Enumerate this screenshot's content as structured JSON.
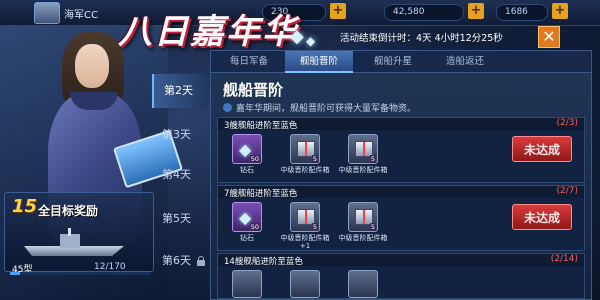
{
  "hud": {
    "player_name": "海军CC",
    "res1": "230",
    "res2": "42,580",
    "res3": "1686"
  },
  "event": {
    "title": "八日嘉年华",
    "countdown": "活动结束倒计时：4天 4小时12分25秒",
    "close_label": "✕"
  },
  "reward": {
    "count": "15",
    "title": "全目标奖励",
    "ship_category": "45型",
    "progress": "12/170",
    "progress_fraction": 0.07
  },
  "days": [
    {
      "label": "第2天",
      "active": true,
      "locked": false
    },
    {
      "label": "第3天",
      "active": false,
      "locked": false
    },
    {
      "label": "第4天",
      "active": false,
      "locked": false
    },
    {
      "label": "第5天",
      "active": false,
      "locked": false
    },
    {
      "label": "第6天",
      "active": false,
      "locked": true
    }
  ],
  "tabs": [
    {
      "label": "每日军备",
      "active": false
    },
    {
      "label": "舰船晋阶",
      "active": true
    },
    {
      "label": "舰船升星",
      "active": false
    },
    {
      "label": "造船返还",
      "active": false
    }
  ],
  "section": {
    "title": "舰船晋阶",
    "tip": "嘉年华期间，舰船晋阶可获得大量军备物资。"
  },
  "tasks": [
    {
      "name": "3艘舰船进阶至蓝色",
      "count": "(2/3)",
      "status": "未达成",
      "items": [
        {
          "type": "purple",
          "icon": "diamond-icon",
          "qty": "50",
          "label": "钻石"
        },
        {
          "type": "grey",
          "icon": "supply-box-icon",
          "qty": "5",
          "label": "中级晋阶配件箱"
        },
        {
          "type": "grey",
          "icon": "supply-box-icon",
          "qty": "5",
          "label": "中级晋阶配件箱"
        }
      ]
    },
    {
      "name": "7艘舰船进阶至蓝色",
      "count": "(2/7)",
      "status": "未达成",
      "items": [
        {
          "type": "purple",
          "icon": "diamond-icon",
          "qty": "50",
          "label": "钻石"
        },
        {
          "type": "grey",
          "icon": "supply-box-icon",
          "qty": "5",
          "label": "中级晋阶配件箱+1"
        },
        {
          "type": "grey",
          "icon": "supply-box-icon",
          "qty": "5",
          "label": "中级晋阶配件箱"
        }
      ]
    },
    {
      "name": "14艘舰船进阶至蓝色",
      "count": "(2/14)",
      "status": "",
      "items": []
    }
  ],
  "colors": {
    "accent": "#4aa0ff",
    "warning": "#d93b3b",
    "close": "#e07a1f"
  }
}
